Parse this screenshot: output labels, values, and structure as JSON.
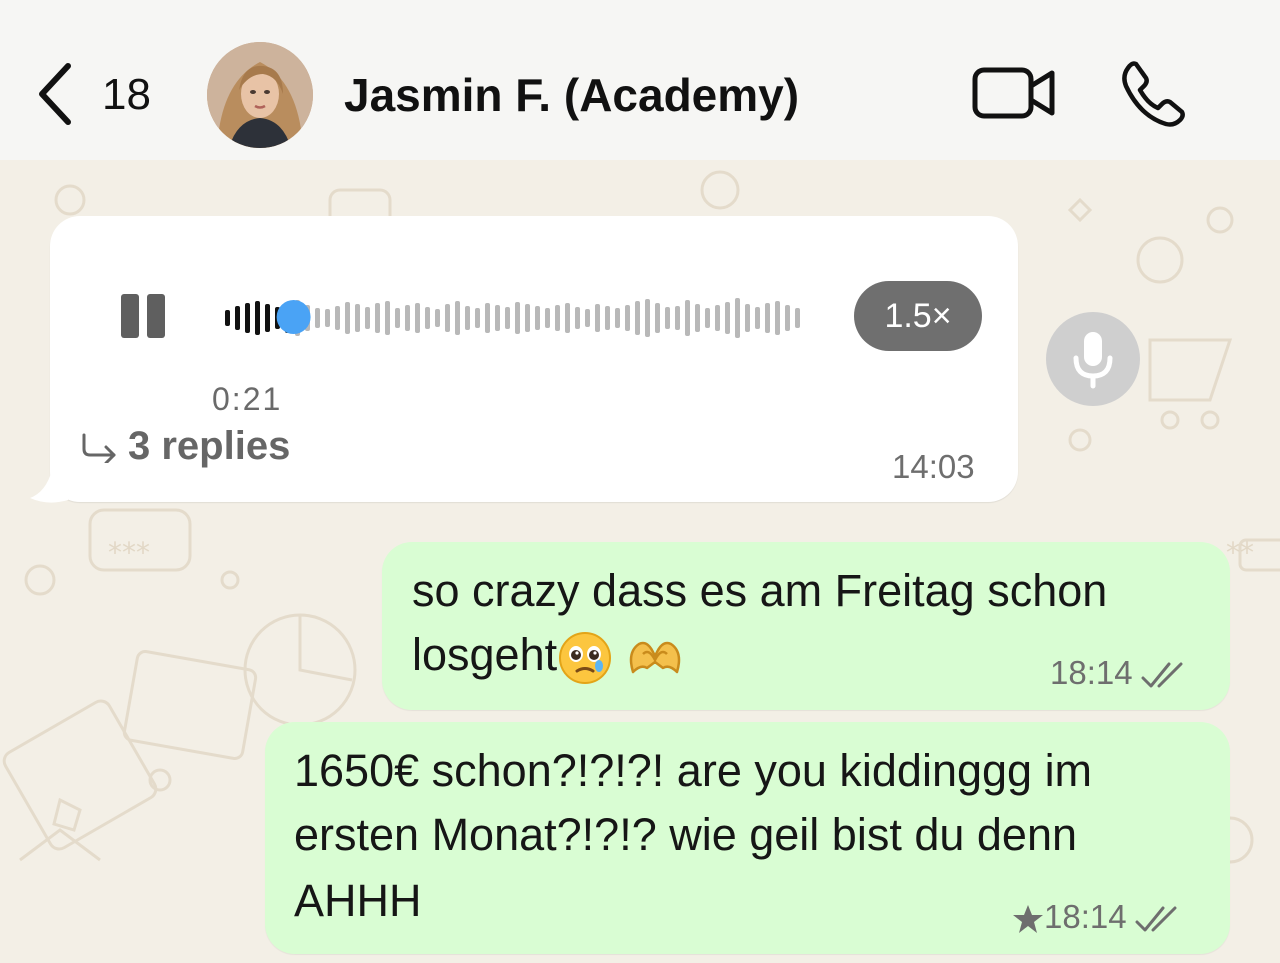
{
  "header": {
    "back_count": "18",
    "contact_name": "Jasmin F. (Academy)"
  },
  "voice_message": {
    "duration": "0:21",
    "playback_speed": "1.5×",
    "progress": 0.12,
    "replies": "3 replies",
    "time": "14:03"
  },
  "messages": [
    {
      "line1": "so crazy dass es am Freitag schon",
      "line2": "losgeht",
      "emojis": [
        "smiling-face-with-tear-emoji",
        "heart-hands-emoji"
      ],
      "time": "18:14",
      "status": "read"
    },
    {
      "line1": "1650€ schon?!?!?! are you kiddinggg im",
      "line2": "ersten Monat?!?!? wie geil bist du denn",
      "line3": "AHHH",
      "starred": true,
      "time": "18:14",
      "status": "read"
    }
  ],
  "colors": {
    "outgoing_bubble": "#d9fdd3",
    "incoming_bubble": "#ffffff",
    "progress_dot": "#4aa3f5",
    "header_bg": "#f6f6f4"
  }
}
